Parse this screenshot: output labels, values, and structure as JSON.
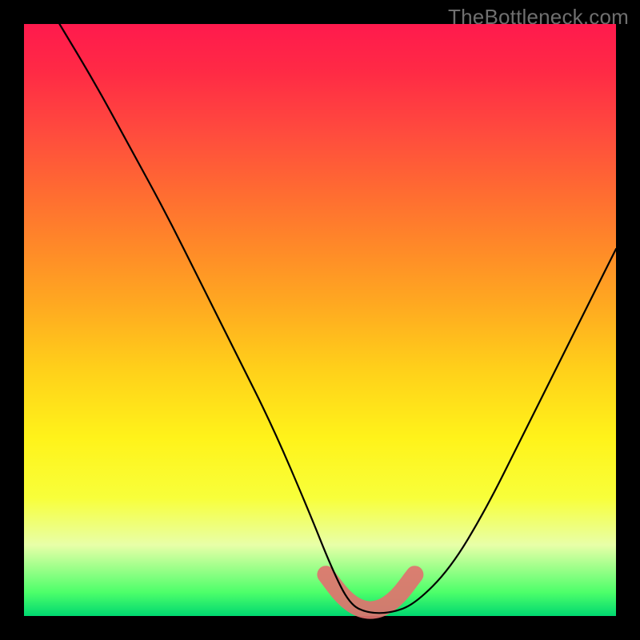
{
  "watermark": "TheBottleneck.com",
  "chart_data": {
    "type": "line",
    "title": "",
    "xlabel": "",
    "ylabel": "",
    "xlim": [
      0,
      100
    ],
    "ylim": [
      0,
      100
    ],
    "grid": false,
    "legend": false,
    "background_gradient": {
      "top": "#ff1a4d",
      "mid": "#ffd21a",
      "bottom": "#00d870"
    },
    "series": [
      {
        "name": "bottleneck-curve",
        "color": "#000000",
        "x": [
          6,
          12,
          18,
          24,
          30,
          36,
          42,
          48,
          52,
          55,
          58,
          62,
          66,
          72,
          78,
          84,
          90,
          96,
          100
        ],
        "y": [
          100,
          90,
          79,
          68,
          56,
          44,
          32,
          18,
          8,
          2,
          0.5,
          0.5,
          2,
          8,
          18,
          30,
          42,
          54,
          62
        ]
      }
    ],
    "highlight_segment": {
      "color": "#e0736f",
      "x": [
        51,
        54,
        57,
        60,
        63,
        66
      ],
      "y": [
        7,
        3,
        1,
        1,
        3,
        7
      ]
    }
  }
}
